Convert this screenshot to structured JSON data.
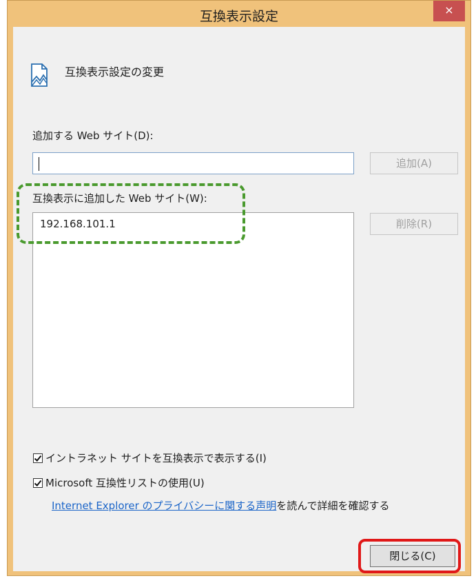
{
  "window": {
    "title": "互換表示設定",
    "close_glyph": "×",
    "header_icon": "website-icon"
  },
  "header": {
    "title": "互換表示設定の変更"
  },
  "add_site": {
    "label": "追加する Web サイト(D):",
    "input_value": "",
    "add_button": "追加(A)"
  },
  "site_list": {
    "label": "互換表示に追加した Web サイト(W):",
    "items": [
      "192.168.101.1"
    ],
    "remove_button": "削除(R)"
  },
  "options": {
    "intranet": {
      "label": "イントラネット サイトを互換表示で表示する(I)",
      "checked": true
    },
    "ms_list": {
      "label": "Microsoft 互換性リストの使用(U)",
      "checked": true
    }
  },
  "privacy": {
    "link_text": "Internet Explorer のプライバシーに関する声明",
    "suffix": "を読んで詳細を確認する"
  },
  "footer": {
    "close_button": "閉じる(C)"
  },
  "colors": {
    "titlebar": "#f0c27b",
    "close_button": "#c75050",
    "link": "#1a64c8",
    "highlight_green": "#4a9a2e",
    "highlight_red": "#e01818"
  }
}
